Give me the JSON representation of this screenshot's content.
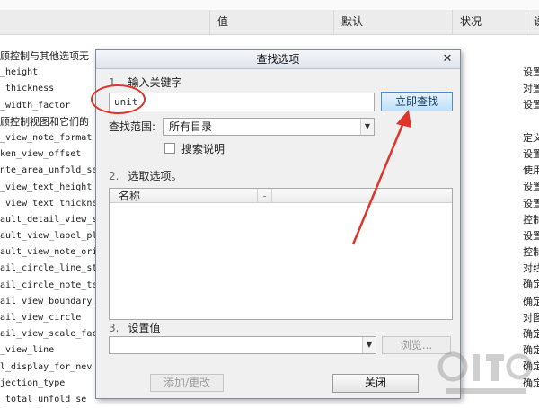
{
  "background_table": {
    "columns": [
      "值",
      "默认",
      "状况",
      "说"
    ],
    "left_rows": [
      "顾控制与其他选项无",
      "_height",
      "_thickness",
      "_width_factor",
      "顾控制视图和它们的",
      "_view_note_format",
      "ken_view_offset",
      "nte_area_unfold_se",
      "_view_text_height",
      "_view_text_thickne",
      "ault_detail_view_s",
      "ault_view_label_pl",
      "ault_view_note_ori",
      "ail_circle_line_st",
      "ail_circle_note_te",
      "ail_view_boundary_",
      "ail_view_circle",
      "ail_view_scale_fac",
      "_view_line",
      "l_display_for_nev",
      "jection_type",
      "_total_unfold_se"
    ],
    "right_rows": [
      "设置",
      "对置",
      "设置",
      "",
      "定义",
      "设置",
      "使用",
      "设置",
      "设置",
      "控制",
      "设置",
      "控制",
      "对线",
      "确定",
      "确定",
      "对图",
      "确定",
      "确定",
      "确定",
      "确定"
    ]
  },
  "dialog": {
    "title": "查找选项",
    "close_symbol": "✕",
    "step1": {
      "number": "1.",
      "label": "输入关键字"
    },
    "keyword_input": {
      "value": "unit"
    },
    "search_button": "立即查找",
    "scope_label": "查找范围:",
    "scope_select": {
      "value": "所有目录"
    },
    "search_desc_checkbox": {
      "label": "搜索说明",
      "checked": false
    },
    "step2": {
      "number": "2.",
      "label": "选取选项。"
    },
    "options_table": {
      "columns": [
        "名称",
        "-"
      ],
      "rows": []
    },
    "step3": {
      "number": "3.",
      "label": "设置值"
    },
    "value_select": {
      "value": ""
    },
    "browse_button": "浏览...",
    "add_change_button": "添加/更改",
    "close_button": "关闭"
  },
  "icons": {
    "dropdown": "chevron-down-icon",
    "close": "close-icon"
  },
  "colors": {
    "annotation": "#e0342b",
    "search_button_border": "#4a90c6"
  }
}
